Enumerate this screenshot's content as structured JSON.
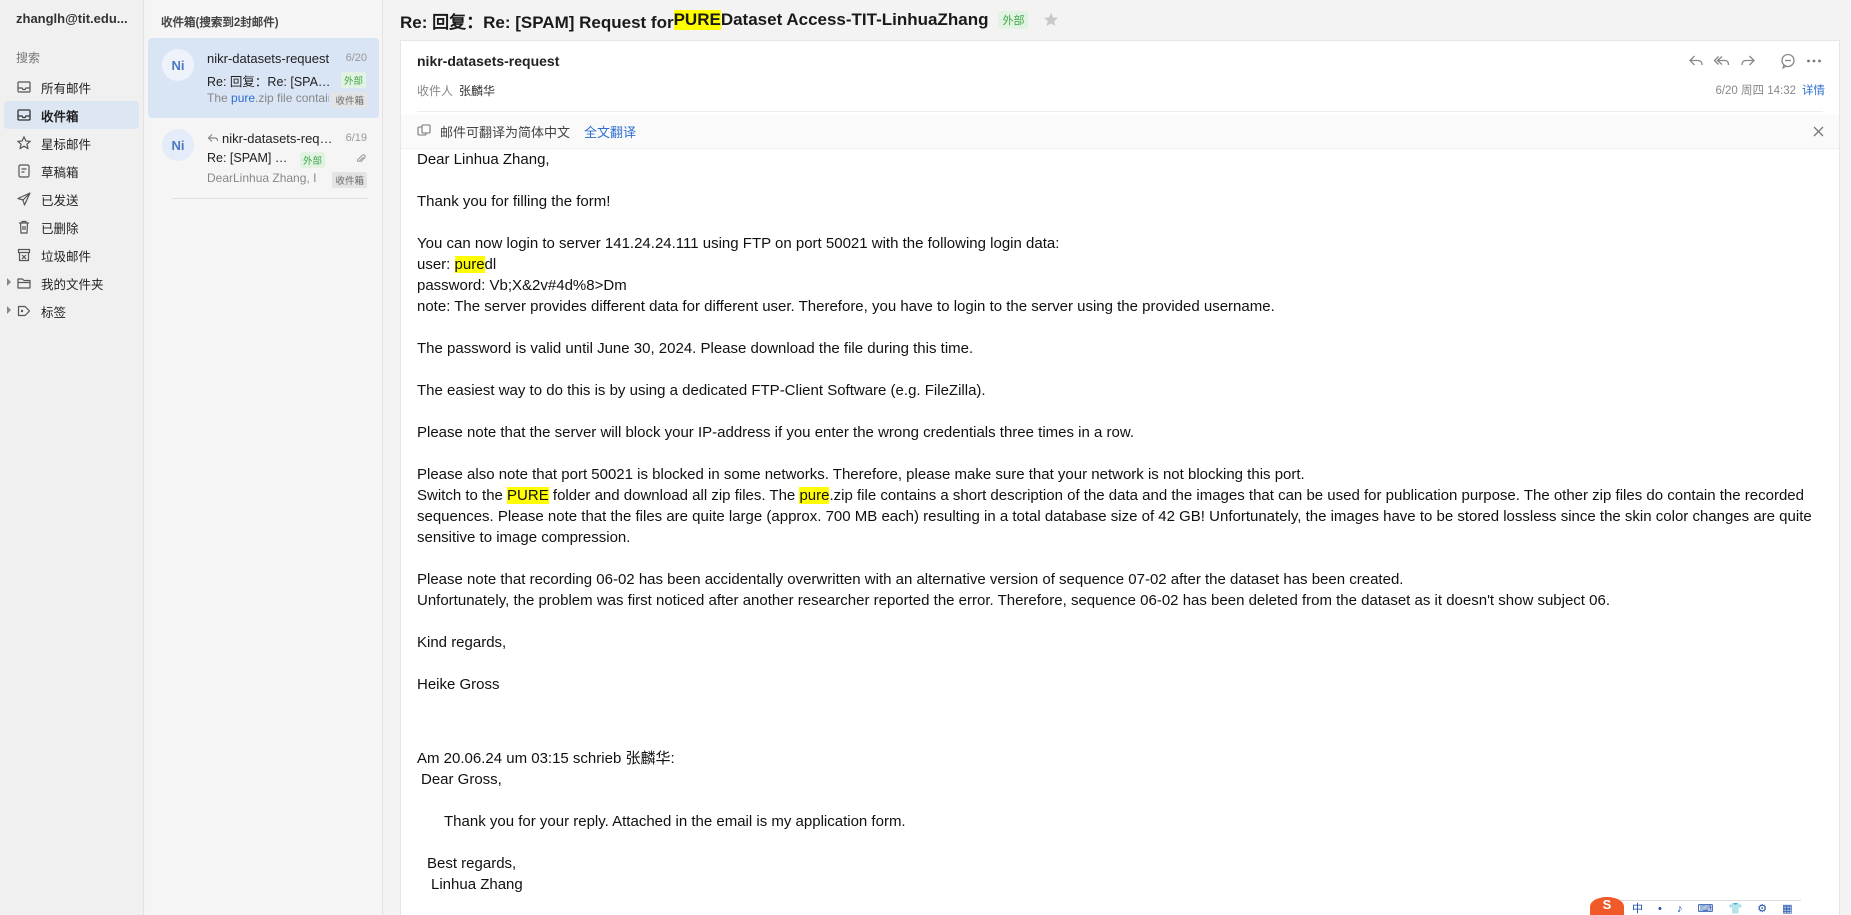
{
  "nav": {
    "account": "zhanglh@tit.edu...",
    "search_label": "搜索",
    "items": [
      {
        "label": "所有邮件",
        "icon": "all-mail-icon"
      },
      {
        "label": "收件箱",
        "icon": "inbox-icon",
        "active": true
      },
      {
        "label": "星标邮件",
        "icon": "star-icon"
      },
      {
        "label": "草稿箱",
        "icon": "draft-icon"
      },
      {
        "label": "已发送",
        "icon": "send-icon"
      },
      {
        "label": "已删除",
        "icon": "trash-icon"
      },
      {
        "label": "垃圾邮件",
        "icon": "spam-icon"
      },
      {
        "label": "我的文件夹",
        "icon": "folder-icon"
      },
      {
        "label": "标签",
        "icon": "tag-icon"
      }
    ]
  },
  "list": {
    "header": "收件箱(搜索到2封邮件)",
    "mails": [
      {
        "avatar": "Ni",
        "from": "nikr-datasets-request",
        "date": "6/20",
        "subject": "Re: 回复：Re: [SPAM] Request for PURE Dataset",
        "tag_ext": "外部",
        "preview_pre": "The ",
        "preview_hl": "pure",
        "preview_post": ".zip file contains",
        "tag_box": "收件箱"
      },
      {
        "avatar": "Ni",
        "from": "nikr-datasets-request",
        "date": "6/19",
        "subject": "Re: [SPAM] Request for PURE Dataset",
        "tag_ext": "外部",
        "preview": "DearLinhua Zhang, I",
        "tag_box": "收件箱"
      }
    ]
  },
  "mail": {
    "subject_pre": "Re: 回复：Re: [SPAM] Request for ",
    "subject_hl": "PURE",
    "subject_post": " Dataset Access-TIT-LinhuaZhang",
    "tag_ext": "外部",
    "sender": "nikr-datasets-request",
    "to_label": "收件人",
    "to_name": "张麟华",
    "datetime": "6/20 周四 14:32",
    "detail": "详情",
    "translate_text": "邮件可翻译为简体中文",
    "translate_link": "全文翻译",
    "body": {
      "greeting": "Dear  Linhua Zhang,",
      "thanks": "Thank you for filling the form!",
      "login": "You can now login to server 141.24.24.111 using FTP on port 50021 with the following login data:",
      "user_pre": "user: ",
      "user_hl": "pure",
      "user_post": "dl",
      "password": "password: Vb;X&2v#4d%8>Dm",
      "note": "note: The server provides different data for different user. Therefore, you have to login to the server using the provided username.",
      "valid": "The password is valid until June 30, 2024. Please download the file during this time.",
      "easiest": "The easiest way to do this is by using a dedicated FTP-Client Software (e.g. FileZilla).",
      "block": "Please note that the server will block your IP-address if you enter the wrong credentials three times in a row.",
      "port": "Please also note that port 50021 is blocked in some networks. Therefore, please make sure that your network is not blocking this port.",
      "switch_1": "Switch to the ",
      "switch_hl1": "PURE",
      "switch_2": " folder and download all zip files. The ",
      "switch_hl2": "pure",
      "switch_3": ".zip file contains a short description of the data and the images that can be used for publication purpose. The other zip files do contain the recorded sequences. Please note that the files are quite large (approx. 700 MB each) resulting in a total database size of 42 GB! Unfortunately, the images have to be stored lossless since the skin color changes are quite sensitive to image compression.",
      "recording": "Please note that recording 06-02 has been accidentally overwritten with an alternative version of sequence 07-02 after the dataset has been created.",
      "problem": "Unfortunately, the problem was first noticed after another researcher reported the error. Therefore, sequence 06-02 has been deleted from the dataset as it doesn't show subject 06.",
      "regards": "Kind regards,",
      "signature": "Heike Gross",
      "quote_header": "Am 20.06.24 um 03:15 schrieb 张麟华:",
      "quote_greeting": "Dear Gross,",
      "quote_thanks": "Thank you for your reply. Attached in the email is my application form.",
      "quote_regards": "Best regards,",
      "quote_name": "Linhua Zhang"
    }
  },
  "ime": {
    "logo": "S",
    "items": "中 • ♪ ⌨ 👕 ⚙ ▦"
  },
  "colors": {
    "accent": "#2e6fd0",
    "highlight": "#ffff00",
    "external_tag": "#3da548",
    "selected_bg": "#d9e4f4"
  }
}
